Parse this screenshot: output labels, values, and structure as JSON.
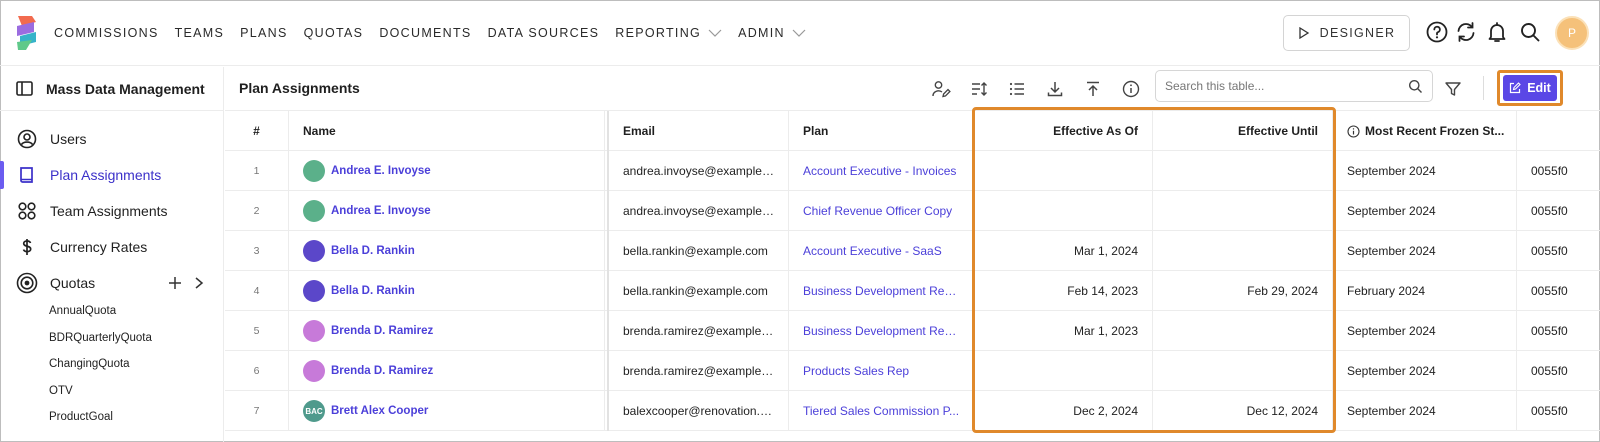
{
  "nav": {
    "items": [
      {
        "label": "COMMISSIONS",
        "dropdown": false
      },
      {
        "label": "TEAMS",
        "dropdown": false
      },
      {
        "label": "PLANS",
        "dropdown": false
      },
      {
        "label": "QUOTAS",
        "dropdown": false
      },
      {
        "label": "DOCUMENTS",
        "dropdown": false
      },
      {
        "label": "DATA SOURCES",
        "dropdown": false
      },
      {
        "label": "REPORTING",
        "dropdown": true
      },
      {
        "label": "ADMIN",
        "dropdown": true
      }
    ],
    "designer_label": "DESIGNER",
    "avatar_initial": "P",
    "icons": [
      "help-icon",
      "refresh-icon",
      "bell-icon",
      "search-icon"
    ]
  },
  "sidebar": {
    "title": "Mass Data Management",
    "items": [
      {
        "label": "Users",
        "icon": "user-circle-icon",
        "active": false
      },
      {
        "label": "Plan Assignments",
        "icon": "book-icon",
        "active": true
      },
      {
        "label": "Team Assignments",
        "icon": "team-icon",
        "active": false
      },
      {
        "label": "Currency Rates",
        "icon": "dollar-icon",
        "active": false
      },
      {
        "label": "Quotas",
        "icon": "target-icon",
        "active": false
      }
    ],
    "quotas": [
      "AnnualQuota",
      "BDRQuarterlyQuota",
      "ChangingQuota",
      "OTV",
      "ProductGoal"
    ]
  },
  "main": {
    "title": "Plan Assignments",
    "search_placeholder": "Search this table...",
    "edit_label": "Edit",
    "accent": "#5a47e6",
    "highlight_color": "#e0892b"
  },
  "table": {
    "headers": {
      "num": "#",
      "name": "Name",
      "email": "Email",
      "plan": "Plan",
      "effective_as_of": "Effective As Of",
      "effective_until": "Effective Until",
      "frozen": "Most Recent Frozen St..."
    },
    "rows": [
      {
        "num": "1",
        "name": "Andrea E. Invoyse",
        "avatar_color": "#5bb08a",
        "initials": "",
        "email": "andrea.invoyse@example....",
        "plan": "Account Executive - Invoices",
        "eff": "",
        "until": "",
        "frozen": "September 2024",
        "id": "0055f0"
      },
      {
        "num": "2",
        "name": "Andrea E. Invoyse",
        "avatar_color": "#5bb08a",
        "initials": "",
        "email": "andrea.invoyse@example....",
        "plan": "Chief Revenue Officer Copy",
        "eff": "",
        "until": "",
        "frozen": "September 2024",
        "id": "0055f0"
      },
      {
        "num": "3",
        "name": "Bella D. Rankin",
        "avatar_color": "#5b47c9",
        "initials": "",
        "email": "bella.rankin@example.com",
        "plan": "Account Executive - SaaS",
        "eff": "Mar 1, 2024",
        "until": "",
        "frozen": "September 2024",
        "id": "0055f0"
      },
      {
        "num": "4",
        "name": "Bella D. Rankin",
        "avatar_color": "#5b47c9",
        "initials": "",
        "email": "bella.rankin@example.com",
        "plan": "Business Development Rep...",
        "eff": "Feb 14, 2023",
        "until": "Feb 29, 2024",
        "frozen": "February 2024",
        "id": "0055f0"
      },
      {
        "num": "5",
        "name": "Brenda D. Ramirez",
        "avatar_color": "#c77ad9",
        "initials": "",
        "email": "brenda.ramirez@example....",
        "plan": "Business Development Rep...",
        "eff": "Mar 1, 2023",
        "until": "",
        "frozen": "September 2024",
        "id": "0055f0"
      },
      {
        "num": "6",
        "name": "Brenda D. Ramirez",
        "avatar_color": "#c77ad9",
        "initials": "",
        "email": "brenda.ramirez@example....",
        "plan": "Products Sales Rep",
        "eff": "",
        "until": "",
        "frozen": "September 2024",
        "id": "0055f0"
      },
      {
        "num": "7",
        "name": "Brett Alex Cooper",
        "avatar_color": "#4f9a8c",
        "initials": "BAC",
        "email": "balexcooper@renovation.c...",
        "plan": "Tiered Sales Commission P...",
        "eff": "Dec 2, 2024",
        "until": "Dec 12, 2024",
        "frozen": "September 2024",
        "id": "0055f0"
      }
    ]
  }
}
